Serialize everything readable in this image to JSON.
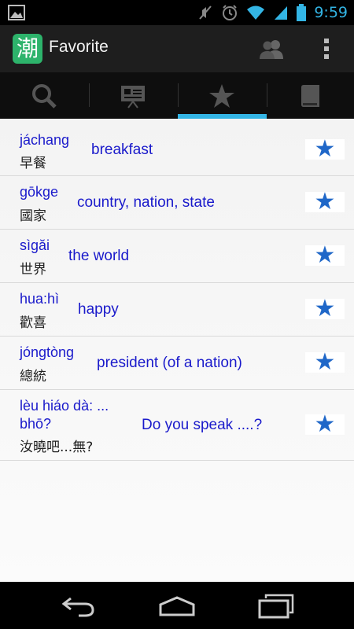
{
  "status_bar": {
    "time": "9:59",
    "icons": [
      "image-icon",
      "mute-icon",
      "alarm-icon",
      "wifi-icon",
      "signal-icon",
      "battery-icon"
    ]
  },
  "action_bar": {
    "logo_char": "潮",
    "title": "Favorite",
    "icons": [
      "people-icon",
      "overflow-menu-icon"
    ]
  },
  "tabs": [
    {
      "icon": "search-icon",
      "selected": false
    },
    {
      "icon": "presentation-icon",
      "selected": false
    },
    {
      "icon": "star-icon",
      "selected": true
    },
    {
      "icon": "book-icon",
      "selected": false
    }
  ],
  "colors": {
    "accent": "#33b5e5",
    "link_text": "#1a1acb",
    "star": "#1f67c8",
    "logo": "#2db36b"
  },
  "favorites": [
    {
      "pinyin": "jáchang",
      "hanzi": "早餐",
      "meaning": "breakfast",
      "starred": true
    },
    {
      "pinyin": "gōkge",
      "hanzi": "國家",
      "meaning": "country, nation, state",
      "starred": true
    },
    {
      "pinyin": "sìgăi",
      "hanzi": "世界",
      "meaning": "the world",
      "starred": true
    },
    {
      "pinyin": "hua:hì",
      "hanzi": "歡喜",
      "meaning": "happy",
      "starred": true
    },
    {
      "pinyin": "jóngtòng",
      "hanzi": "總統",
      "meaning": "president (of a nation)",
      "starred": true
    },
    {
      "pinyin": "lèu hiáo dà: ...",
      "pinyin2": "bhō?",
      "hanzi": "汝曉吧...無?",
      "meaning": "Do you speak ....?",
      "starred": true
    }
  ],
  "star_glyph": "★",
  "nav_bar": {
    "icons": [
      "back-icon",
      "home-icon",
      "recent-apps-icon"
    ]
  }
}
